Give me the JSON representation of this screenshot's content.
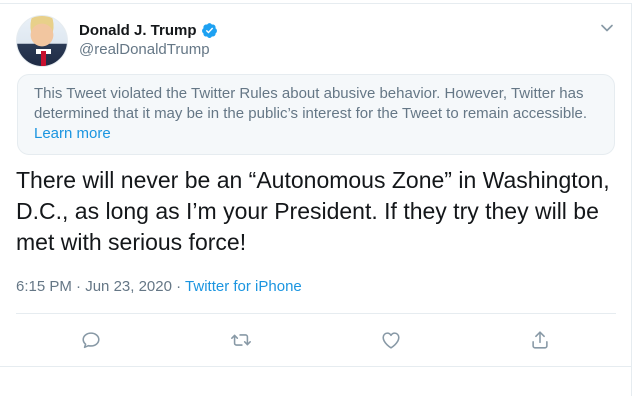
{
  "author": {
    "display_name": "Donald J. Trump",
    "handle": "@realDonaldTrump",
    "verified": true
  },
  "notice": {
    "text": "This Tweet violated the Twitter Rules about abusive behavior. However, Twitter has determined that it may be in the public’s interest for the Tweet to remain accessible.",
    "link_label": "Learn more"
  },
  "tweet": {
    "text": "There will never be an “Autonomous Zone” in Washington, D.C., as long as I’m your President. If they try they will be met with serious force!"
  },
  "meta": {
    "time": "6:15 PM",
    "separator": "·",
    "date": "Jun 23, 2020",
    "source": "Twitter for iPhone"
  },
  "icons": {
    "verified": "verified-badge-icon",
    "menu": "chevron-down-icon",
    "reply": "reply-icon",
    "retweet": "retweet-icon",
    "like": "heart-icon",
    "share": "share-icon"
  },
  "colors": {
    "accent": "#1b95e0",
    "secondary_text": "#657786",
    "icon_gray": "#8899a6"
  }
}
